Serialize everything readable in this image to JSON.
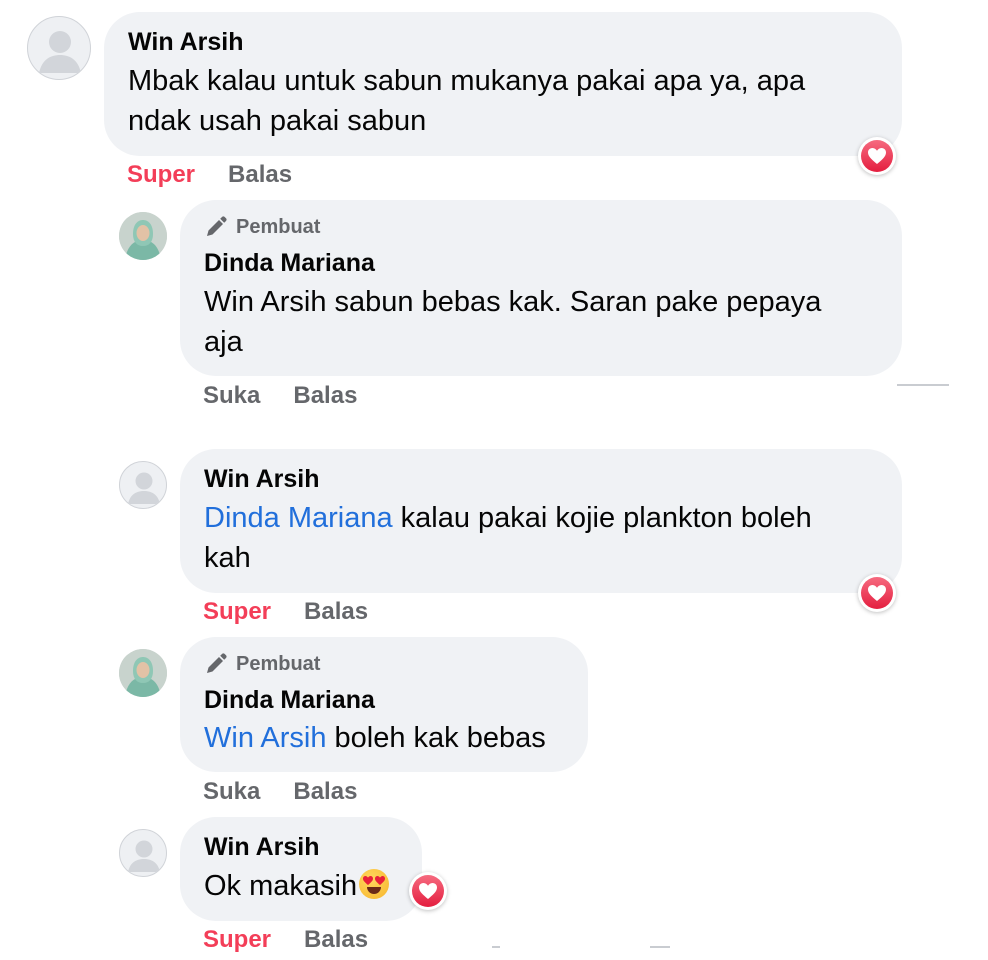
{
  "comments": [
    {
      "author": "Win Arsih",
      "text": "Mbak kalau untuk sabun mukanya pakai apa ya, apa ndak usah pakai sabun",
      "actions": {
        "react": "Super",
        "reply": "Balas"
      },
      "reaction": "love",
      "replies": [
        {
          "badge": "Pembuat",
          "author": "Dinda Mariana",
          "text": "Win Arsih sabun bebas kak. Saran pake pepaya aja",
          "actions": {
            "react": "Suka",
            "reply": "Balas"
          }
        },
        {
          "author": "Win Arsih",
          "mention": "Dinda Mariana",
          "text": " kalau pakai kojie plankton boleh kah",
          "actions": {
            "react": "Super",
            "reply": "Balas"
          },
          "reaction": "love"
        },
        {
          "badge": "Pembuat",
          "author": "Dinda Mariana",
          "mention": "Win Arsih",
          "text": " boleh kak bebas",
          "actions": {
            "react": "Suka",
            "reply": "Balas"
          }
        },
        {
          "author": "Win Arsih",
          "text": "Ok makasih",
          "emoji": "heart-eyes-emoji",
          "actions": {
            "react": "Super",
            "reply": "Balas"
          },
          "reaction": "love"
        }
      ]
    }
  ],
  "colors": {
    "bubble": "#f0f2f5",
    "love": "#f33e58",
    "link": "#216fdb",
    "muted": "#65676b"
  },
  "icons": [
    "default-avatar-icon",
    "profile-photo-avatar",
    "pencil-icon",
    "love-reaction-icon"
  ]
}
